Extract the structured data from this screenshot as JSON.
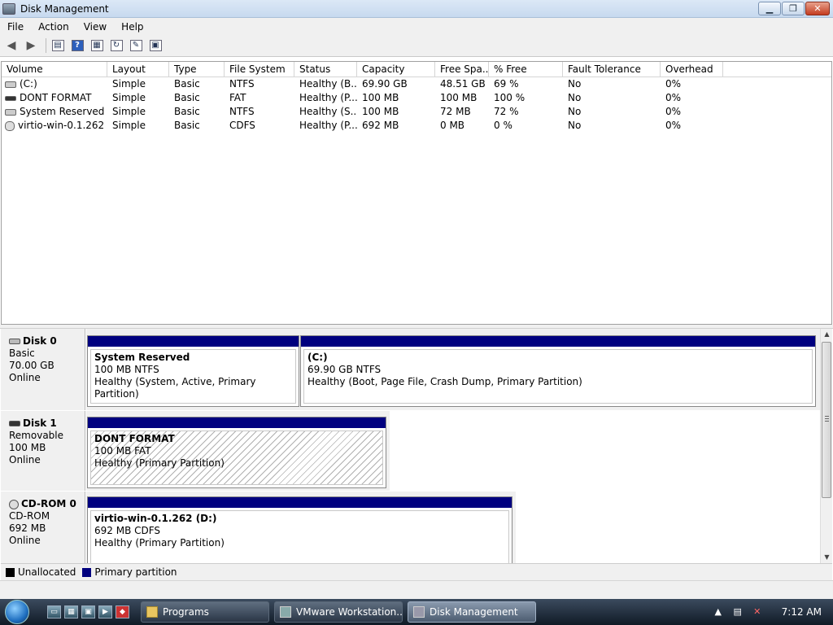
{
  "window": {
    "title": "Disk Management",
    "min": "▁",
    "max": "❐",
    "close": "✕"
  },
  "menu": [
    "File",
    "Action",
    "View",
    "Help"
  ],
  "volume_list": {
    "columns": [
      "Volume",
      "Layout",
      "Type",
      "File System",
      "Status",
      "Capacity",
      "Free Spa...",
      "% Free",
      "Fault Tolerance",
      "Overhead"
    ],
    "rows": [
      {
        "icon": "drive-icon",
        "volume": "(C:)",
        "layout": "Simple",
        "type": "Basic",
        "fs": "NTFS",
        "status": "Healthy (B...",
        "capacity": "69.90 GB",
        "free": "48.51 GB",
        "pct": "69 %",
        "fault": "No",
        "overhead": "0%"
      },
      {
        "icon": "removable-drive-icon",
        "volume": "DONT FORMAT",
        "layout": "Simple",
        "type": "Basic",
        "fs": "FAT",
        "status": "Healthy (P...",
        "capacity": "100 MB",
        "free": "100 MB",
        "pct": "100 %",
        "fault": "No",
        "overhead": "0%"
      },
      {
        "icon": "drive-icon",
        "volume": "System Reserved",
        "layout": "Simple",
        "type": "Basic",
        "fs": "NTFS",
        "status": "Healthy (S...",
        "capacity": "100 MB",
        "free": "72 MB",
        "pct": "72 %",
        "fault": "No",
        "overhead": "0%"
      },
      {
        "icon": "cdrom-icon",
        "volume": "virtio-win-0.1.262 ...",
        "layout": "Simple",
        "type": "Basic",
        "fs": "CDFS",
        "status": "Healthy (P...",
        "capacity": "692 MB",
        "free": "0 MB",
        "pct": "0 %",
        "fault": "No",
        "overhead": "0%"
      }
    ]
  },
  "disks": [
    {
      "name": "Disk 0",
      "type": "Basic",
      "size": "70.00 GB",
      "state": "Online",
      "partitions": [
        {
          "title": "System Reserved",
          "size": "100 MB NTFS",
          "status": "Healthy (System, Active, Primary Partition)"
        },
        {
          "title": "(C:)",
          "size": "69.90 GB NTFS",
          "status": "Healthy (Boot, Page File, Crash Dump, Primary Partition)"
        }
      ]
    },
    {
      "name": "Disk 1",
      "type": "Removable",
      "size": "100 MB",
      "state": "Online",
      "partitions": [
        {
          "title": "DONT FORMAT",
          "size": "100 MB FAT",
          "status": "Healthy (Primary Partition)"
        }
      ]
    },
    {
      "name": "CD-ROM 0",
      "type": "CD-ROM",
      "size": "692 MB",
      "state": "Online",
      "partitions": [
        {
          "title": "virtio-win-0.1.262  (D:)",
          "size": "692 MB CDFS",
          "status": "Healthy (Primary Partition)"
        }
      ]
    }
  ],
  "legend": [
    {
      "label": "Unallocated",
      "color": "#000000"
    },
    {
      "label": "Primary partition",
      "color": "#00007f"
    }
  ],
  "taskbar": {
    "tasks": [
      "Programs",
      "VMware Workstation...",
      "Disk Management"
    ],
    "clock": "7:12 AM"
  },
  "colors": {
    "primary_partition": "#00007f"
  }
}
